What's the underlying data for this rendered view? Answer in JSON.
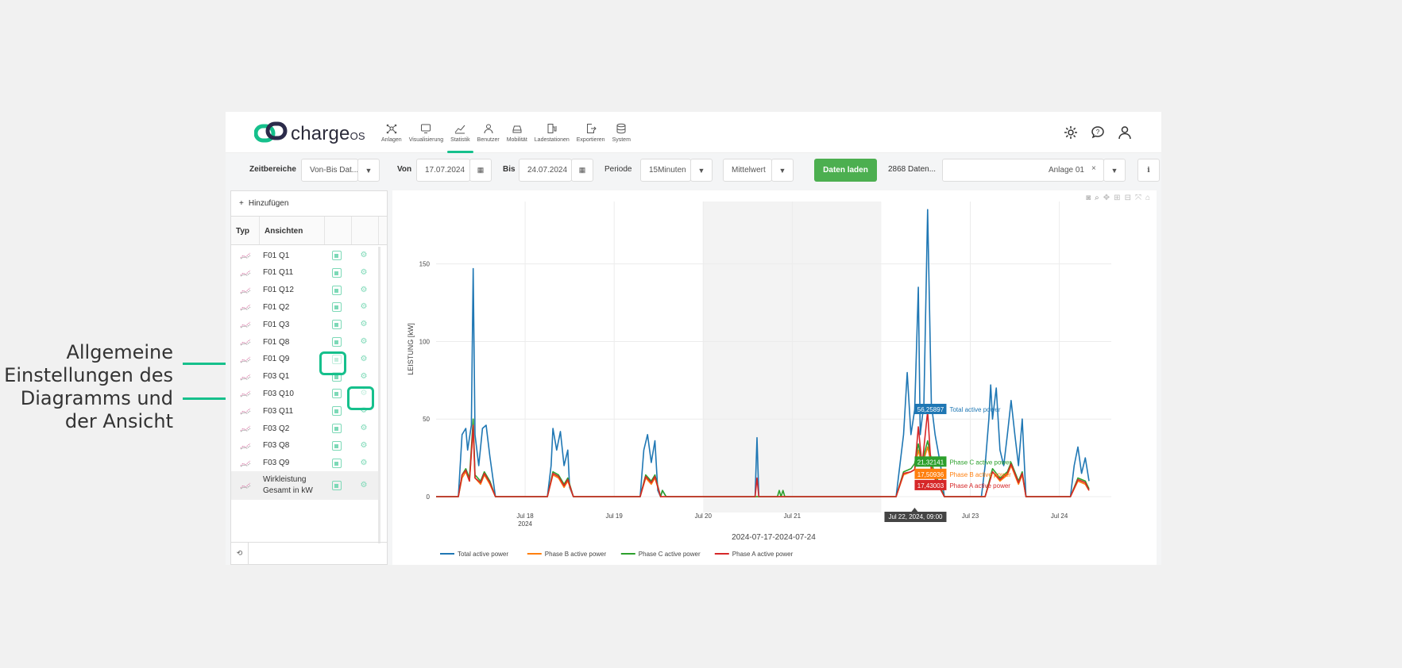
{
  "annotation": {
    "lines": [
      "Allgemeine",
      "Einstellungen des",
      "Diagramms und",
      "der Ansicht"
    ]
  },
  "brand": {
    "name": "charge",
    "sup": "OS"
  },
  "nav": [
    {
      "label": "Anlagen",
      "icon": "network-icon"
    },
    {
      "label": "Visualisierung",
      "icon": "monitor-icon"
    },
    {
      "label": "Statistik",
      "icon": "chart-icon",
      "active": true
    },
    {
      "label": "Benutzer",
      "icon": "user-icon"
    },
    {
      "label": "Mobilität",
      "icon": "car-icon"
    },
    {
      "label": "Ladestationen",
      "icon": "charger-icon"
    },
    {
      "label": "Exportieren",
      "icon": "export-icon"
    },
    {
      "label": "System",
      "icon": "database-icon"
    }
  ],
  "toolbar": {
    "range_label": "Zeitbereiche",
    "range_value": "Von-Bis Dat...",
    "from_label": "Von",
    "from_value": "17.07.2024",
    "to_label": "Bis",
    "to_value": "24.07.2024",
    "period_label": "Periode",
    "period_value": "15Minuten",
    "agg_value": "Mittelwert",
    "load_label": "Daten laden",
    "count_text": "2868 Daten...",
    "plant_value": "Anlage 01",
    "info_label": "i"
  },
  "panel": {
    "add_label": "Hinzufügen",
    "col_typ": "Typ",
    "col_views": "Ansichten",
    "rows": [
      "F01 Q1",
      "F01 Q11",
      "F01 Q12",
      "F01 Q2",
      "F01 Q3",
      "F01 Q8",
      "F01 Q9",
      "F03 Q1",
      "F03 Q10",
      "F03 Q11",
      "F03 Q2",
      "F03 Q8",
      "F03 Q9"
    ],
    "last_row": [
      "Wirkleistung",
      "Gesamt in kW"
    ]
  },
  "colors": {
    "total": "#1f77b4",
    "phase_b": "#ff7f0e",
    "phase_c": "#2ca02c",
    "phase_a": "#d62728",
    "accent": "#16c08c"
  },
  "chart_data": {
    "type": "line",
    "ylabel": "LEISTUNG [kW]",
    "xlabel": "2024-07-17-2024-07-24",
    "yticks": [
      0,
      50,
      100,
      150
    ],
    "ylim": [
      0,
      180
    ],
    "xlim": [
      "2024-07-17T00:00",
      "2024-07-24T14:00"
    ],
    "xticks": [
      {
        "label": "Jul 18",
        "sub": "2024",
        "x": "2024-07-18T00:00"
      },
      {
        "label": "Jul 19",
        "x": "2024-07-19T00:00"
      },
      {
        "label": "Jul 20",
        "x": "2024-07-20T00:00"
      },
      {
        "label": "Jul 21",
        "x": "2024-07-21T00:00"
      },
      {
        "label": "Jul 23",
        "x": "2024-07-23T00:00"
      },
      {
        "label": "Jul 24",
        "x": "2024-07-24T00:00"
      }
    ],
    "grid": true,
    "legend_position": "bottom",
    "shaded_range": [
      "2024-07-20T00:00",
      "2024-07-22T00:00"
    ],
    "hover": {
      "x_label": "Jul 22, 2024, 09:00",
      "x": "2024-07-22T09:00",
      "items": [
        {
          "series": "Total active power",
          "value": "56,25897",
          "y": 56.26
        },
        {
          "series": "Phase C active power",
          "value": "21,32141",
          "y": 21.32
        },
        {
          "series": "Phase B active power",
          "value": "17,50936",
          "y": 17.51
        },
        {
          "series": "Phase A active power",
          "value": "17,43003",
          "y": 17.43
        }
      ]
    },
    "series": [
      {
        "name": "Total active power",
        "color": "#1f77b4",
        "points": [
          [
            "2024-07-17T00:00",
            0
          ],
          [
            "2024-07-17T06:00",
            0
          ],
          [
            "2024-07-17T07:00",
            40
          ],
          [
            "2024-07-17T08:00",
            44
          ],
          [
            "2024-07-17T08:30",
            30
          ],
          [
            "2024-07-17T09:30",
            46
          ],
          [
            "2024-07-17T10:00",
            147
          ],
          [
            "2024-07-17T10:30",
            40
          ],
          [
            "2024-07-17T11:30",
            20
          ],
          [
            "2024-07-17T12:30",
            44
          ],
          [
            "2024-07-17T13:30",
            46
          ],
          [
            "2024-07-17T14:30",
            26
          ],
          [
            "2024-07-17T16:00",
            0
          ],
          [
            "2024-07-18T06:00",
            0
          ],
          [
            "2024-07-18T07:00",
            20
          ],
          [
            "2024-07-18T07:30",
            44
          ],
          [
            "2024-07-18T08:30",
            30
          ],
          [
            "2024-07-18T09:30",
            42
          ],
          [
            "2024-07-18T10:30",
            20
          ],
          [
            "2024-07-18T11:30",
            30
          ],
          [
            "2024-07-18T12:00",
            6
          ],
          [
            "2024-07-18T13:00",
            0
          ],
          [
            "2024-07-19T07:00",
            0
          ],
          [
            "2024-07-19T08:00",
            30
          ],
          [
            "2024-07-19T09:00",
            40
          ],
          [
            "2024-07-19T10:00",
            22
          ],
          [
            "2024-07-19T11:00",
            36
          ],
          [
            "2024-07-19T11:45",
            4
          ],
          [
            "2024-07-19T12:30",
            0
          ],
          [
            "2024-07-19T13:00",
            4
          ],
          [
            "2024-07-19T14:00",
            0
          ],
          [
            "2024-07-20T14:00",
            0
          ],
          [
            "2024-07-20T14:30",
            38
          ],
          [
            "2024-07-20T15:00",
            0
          ],
          [
            "2024-07-22T04:00",
            0
          ],
          [
            "2024-07-22T05:00",
            20
          ],
          [
            "2024-07-22T06:00",
            40
          ],
          [
            "2024-07-22T07:00",
            80
          ],
          [
            "2024-07-22T08:00",
            40
          ],
          [
            "2024-07-22T09:00",
            56
          ],
          [
            "2024-07-22T10:00",
            135
          ],
          [
            "2024-07-22T10:30",
            40
          ],
          [
            "2024-07-22T11:30",
            60
          ],
          [
            "2024-07-22T12:30",
            185
          ],
          [
            "2024-07-22T13:30",
            60
          ],
          [
            "2024-07-22T14:30",
            40
          ],
          [
            "2024-07-22T16:00",
            20
          ],
          [
            "2024-07-22T17:00",
            0
          ],
          [
            "2024-07-23T03:00",
            0
          ],
          [
            "2024-07-23T04:00",
            20
          ],
          [
            "2024-07-23T05:00",
            50
          ],
          [
            "2024-07-23T05:30",
            72
          ],
          [
            "2024-07-23T06:00",
            50
          ],
          [
            "2024-07-23T07:00",
            70
          ],
          [
            "2024-07-23T08:00",
            30
          ],
          [
            "2024-07-23T09:00",
            20
          ],
          [
            "2024-07-23T10:00",
            40
          ],
          [
            "2024-07-23T11:00",
            62
          ],
          [
            "2024-07-23T12:00",
            40
          ],
          [
            "2024-07-23T13:00",
            20
          ],
          [
            "2024-07-23T14:00",
            50
          ],
          [
            "2024-07-23T15:00",
            0
          ],
          [
            "2024-07-24T03:00",
            0
          ],
          [
            "2024-07-24T04:00",
            20
          ],
          [
            "2024-07-24T05:00",
            32
          ],
          [
            "2024-07-24T06:00",
            15
          ],
          [
            "2024-07-24T07:00",
            25
          ],
          [
            "2024-07-24T08:00",
            10
          ]
        ]
      },
      {
        "name": "Phase B active power",
        "color": "#ff7f0e",
        "points": [
          [
            "2024-07-17T00:00",
            0
          ],
          [
            "2024-07-17T06:00",
            0
          ],
          [
            "2024-07-17T07:00",
            12
          ],
          [
            "2024-07-17T08:00",
            16
          ],
          [
            "2024-07-17T09:00",
            10
          ],
          [
            "2024-07-17T10:00",
            44
          ],
          [
            "2024-07-17T10:30",
            12
          ],
          [
            "2024-07-17T12:00",
            8
          ],
          [
            "2024-07-17T13:00",
            14
          ],
          [
            "2024-07-17T14:30",
            8
          ],
          [
            "2024-07-17T16:00",
            0
          ],
          [
            "2024-07-18T06:00",
            0
          ],
          [
            "2024-07-18T07:30",
            14
          ],
          [
            "2024-07-18T09:00",
            12
          ],
          [
            "2024-07-18T10:30",
            6
          ],
          [
            "2024-07-18T11:30",
            10
          ],
          [
            "2024-07-18T13:00",
            0
          ],
          [
            "2024-07-19T07:00",
            0
          ],
          [
            "2024-07-19T08:30",
            12
          ],
          [
            "2024-07-19T10:00",
            8
          ],
          [
            "2024-07-19T11:00",
            12
          ],
          [
            "2024-07-19T12:30",
            0
          ],
          [
            "2024-07-22T04:00",
            0
          ],
          [
            "2024-07-22T06:00",
            14
          ],
          [
            "2024-07-22T08:00",
            16
          ],
          [
            "2024-07-22T09:00",
            17.5
          ],
          [
            "2024-07-22T10:00",
            30
          ],
          [
            "2024-07-22T11:00",
            20
          ],
          [
            "2024-07-22T12:30",
            32
          ],
          [
            "2024-07-22T14:00",
            15
          ],
          [
            "2024-07-22T17:00",
            0
          ],
          [
            "2024-07-23T04:00",
            0
          ],
          [
            "2024-07-23T06:00",
            16
          ],
          [
            "2024-07-23T08:00",
            10
          ],
          [
            "2024-07-23T10:00",
            14
          ],
          [
            "2024-07-23T11:00",
            20
          ],
          [
            "2024-07-23T13:00",
            8
          ],
          [
            "2024-07-23T14:00",
            14
          ],
          [
            "2024-07-23T15:00",
            0
          ],
          [
            "2024-07-24T03:00",
            0
          ],
          [
            "2024-07-24T05:00",
            10
          ],
          [
            "2024-07-24T07:00",
            8
          ],
          [
            "2024-07-24T08:00",
            4
          ]
        ]
      },
      {
        "name": "Phase C active power",
        "color": "#2ca02c",
        "points": [
          [
            "2024-07-17T00:00",
            0
          ],
          [
            "2024-07-17T06:00",
            0
          ],
          [
            "2024-07-17T07:00",
            14
          ],
          [
            "2024-07-17T08:00",
            18
          ],
          [
            "2024-07-17T09:00",
            12
          ],
          [
            "2024-07-17T10:00",
            50
          ],
          [
            "2024-07-17T10:30",
            14
          ],
          [
            "2024-07-17T12:00",
            10
          ],
          [
            "2024-07-17T13:00",
            16
          ],
          [
            "2024-07-17T14:30",
            10
          ],
          [
            "2024-07-17T16:00",
            0
          ],
          [
            "2024-07-18T06:00",
            0
          ],
          [
            "2024-07-18T07:30",
            16
          ],
          [
            "2024-07-18T09:00",
            14
          ],
          [
            "2024-07-18T10:30",
            8
          ],
          [
            "2024-07-18T11:30",
            12
          ],
          [
            "2024-07-18T13:00",
            0
          ],
          [
            "2024-07-19T07:00",
            0
          ],
          [
            "2024-07-19T08:30",
            14
          ],
          [
            "2024-07-19T10:00",
            10
          ],
          [
            "2024-07-19T11:00",
            14
          ],
          [
            "2024-07-19T12:30",
            0
          ],
          [
            "2024-07-19T13:00",
            4
          ],
          [
            "2024-07-19T14:00",
            0
          ],
          [
            "2024-07-20T20:00",
            0
          ],
          [
            "2024-07-20T20:30",
            4
          ],
          [
            "2024-07-20T21:00",
            0
          ],
          [
            "2024-07-20T21:30",
            4
          ],
          [
            "2024-07-20T22:00",
            0
          ],
          [
            "2024-07-22T04:00",
            0
          ],
          [
            "2024-07-22T06:00",
            16
          ],
          [
            "2024-07-22T08:00",
            18
          ],
          [
            "2024-07-22T09:00",
            21.3
          ],
          [
            "2024-07-22T10:00",
            34
          ],
          [
            "2024-07-22T11:00",
            22
          ],
          [
            "2024-07-22T12:30",
            36
          ],
          [
            "2024-07-22T14:00",
            18
          ],
          [
            "2024-07-22T17:00",
            0
          ],
          [
            "2024-07-23T04:00",
            0
          ],
          [
            "2024-07-23T06:00",
            18
          ],
          [
            "2024-07-23T08:00",
            12
          ],
          [
            "2024-07-23T10:00",
            16
          ],
          [
            "2024-07-23T11:00",
            22
          ],
          [
            "2024-07-23T13:00",
            10
          ],
          [
            "2024-07-23T14:00",
            16
          ],
          [
            "2024-07-23T15:00",
            0
          ],
          [
            "2024-07-24T03:00",
            0
          ],
          [
            "2024-07-24T05:00",
            12
          ],
          [
            "2024-07-24T07:00",
            10
          ],
          [
            "2024-07-24T08:00",
            5
          ]
        ]
      },
      {
        "name": "Phase A active power",
        "color": "#d62728",
        "points": [
          [
            "2024-07-17T00:00",
            0
          ],
          [
            "2024-07-17T06:00",
            0
          ],
          [
            "2024-07-17T07:00",
            14
          ],
          [
            "2024-07-17T08:00",
            17
          ],
          [
            "2024-07-17T09:00",
            10
          ],
          [
            "2024-07-17T10:00",
            46
          ],
          [
            "2024-07-17T10:30",
            12
          ],
          [
            "2024-07-17T12:00",
            9
          ],
          [
            "2024-07-17T13:00",
            15
          ],
          [
            "2024-07-17T14:30",
            9
          ],
          [
            "2024-07-17T16:00",
            0
          ],
          [
            "2024-07-18T06:00",
            0
          ],
          [
            "2024-07-18T07:30",
            15
          ],
          [
            "2024-07-18T09:00",
            13
          ],
          [
            "2024-07-18T10:30",
            7
          ],
          [
            "2024-07-18T11:30",
            11
          ],
          [
            "2024-07-18T13:00",
            0
          ],
          [
            "2024-07-19T07:00",
            0
          ],
          [
            "2024-07-19T08:30",
            13
          ],
          [
            "2024-07-19T10:00",
            9
          ],
          [
            "2024-07-19T11:00",
            13
          ],
          [
            "2024-07-19T12:30",
            0
          ],
          [
            "2024-07-20T14:00",
            0
          ],
          [
            "2024-07-20T14:30",
            12
          ],
          [
            "2024-07-20T15:00",
            0
          ],
          [
            "2024-07-22T04:00",
            0
          ],
          [
            "2024-07-22T06:00",
            15
          ],
          [
            "2024-07-22T08:00",
            16
          ],
          [
            "2024-07-22T09:00",
            17.4
          ],
          [
            "2024-07-22T10:00",
            45
          ],
          [
            "2024-07-22T11:00",
            20
          ],
          [
            "2024-07-22T12:30",
            55
          ],
          [
            "2024-07-22T13:30",
            16
          ],
          [
            "2024-07-22T17:00",
            0
          ],
          [
            "2024-07-23T04:00",
            0
          ],
          [
            "2024-07-23T06:00",
            16
          ],
          [
            "2024-07-23T08:00",
            11
          ],
          [
            "2024-07-23T10:00",
            15
          ],
          [
            "2024-07-23T11:00",
            21
          ],
          [
            "2024-07-23T13:00",
            9
          ],
          [
            "2024-07-23T14:00",
            15
          ],
          [
            "2024-07-23T15:00",
            0
          ],
          [
            "2024-07-24T03:00",
            0
          ],
          [
            "2024-07-24T05:00",
            11
          ],
          [
            "2024-07-24T07:00",
            9
          ],
          [
            "2024-07-24T08:00",
            4
          ]
        ]
      }
    ],
    "legend": [
      "Total active power",
      "Phase B active power",
      "Phase C active power",
      "Phase A active power"
    ]
  }
}
